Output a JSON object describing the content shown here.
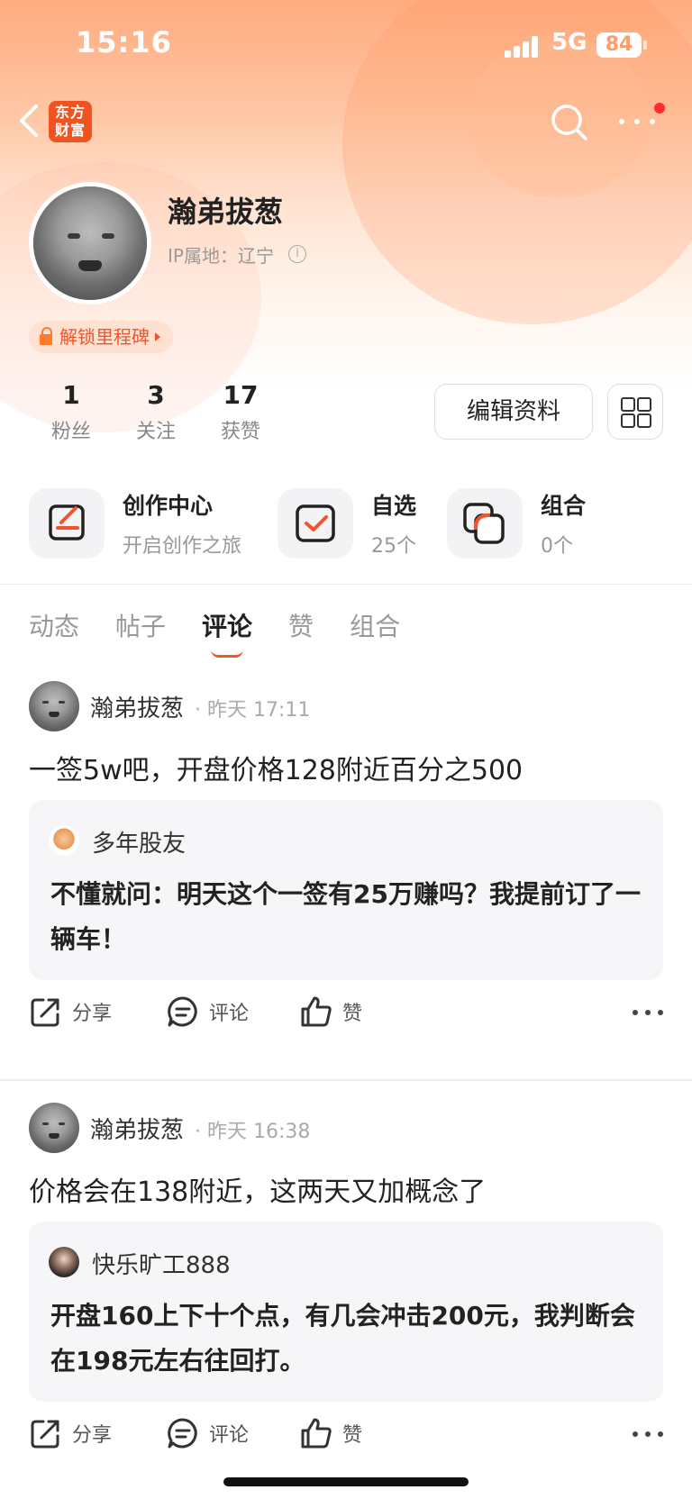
{
  "status": {
    "time": "15:16",
    "network": "5G",
    "battery": "84"
  },
  "brand": {
    "logo_text": "东方财富"
  },
  "profile": {
    "name": "瀚弟拔葱",
    "ip_location": "IP属地：辽宁",
    "milestone": "解锁里程碑",
    "stats": [
      {
        "value": "1",
        "label": "粉丝"
      },
      {
        "value": "3",
        "label": "关注"
      },
      {
        "value": "17",
        "label": "获赞"
      }
    ],
    "edit_button": "编辑资料"
  },
  "features": [
    {
      "title": "创作中心",
      "subtitle": "开启创作之旅"
    },
    {
      "title": "自选",
      "subtitle": "25个"
    },
    {
      "title": "组合",
      "subtitle": "0个"
    }
  ],
  "tabs": [
    "动态",
    "帖子",
    "评论",
    "赞",
    "组合"
  ],
  "active_tab": "评论",
  "posts": [
    {
      "author": "瀚弟拔葱",
      "time": "昨天 17:11",
      "text": "一签5w吧，开盘价格128附近百分之500",
      "quote": {
        "author": "多年股友",
        "text": "不懂就问：明天这个一签有25万赚吗？我提前订了一辆车！"
      }
    },
    {
      "author": "瀚弟拔葱",
      "time": "昨天 16:38",
      "text": "价格会在138附近，这两天又加概念了",
      "quote": {
        "author": "快乐旷工888",
        "text": "开盘160上下十个点，有几会冲击200元，我判断会在198元左右往回打。"
      }
    }
  ],
  "actions": {
    "share": "分享",
    "comment": "评论",
    "like": "赞"
  },
  "colors": {
    "accent": "#f2542b",
    "header_top": "#ffab7e"
  }
}
